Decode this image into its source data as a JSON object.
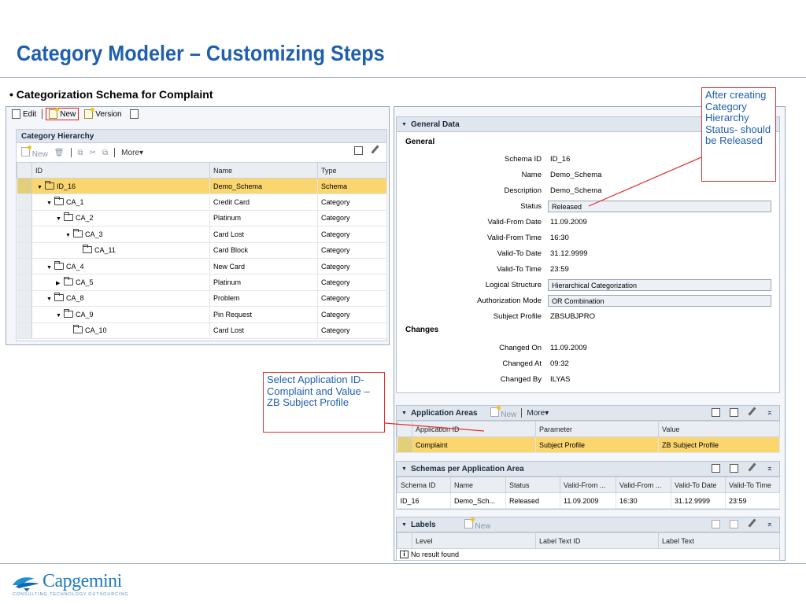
{
  "slide": {
    "title": "Category Modeler – Customizing Steps",
    "bullet": "• Categorization Schema for Complaint"
  },
  "left_window": {
    "toolbar": {
      "edit": "Edit",
      "new": "New",
      "version": "Version"
    },
    "panel_title": "Category Hierarchy",
    "panel_toolbar": {
      "new": "New",
      "more": "More"
    },
    "columns": [
      "ID",
      "Name",
      "Type"
    ],
    "rows": [
      {
        "id": "ID_16",
        "name": "Demo_Schema",
        "type": "Schema",
        "level": 1,
        "toggle": "down",
        "highlighted": true
      },
      {
        "id": "CA_1",
        "name": "Credit Card",
        "type": "Category",
        "level": 2,
        "toggle": "down"
      },
      {
        "id": "CA_2",
        "name": "Platinum",
        "type": "Category",
        "level": 3,
        "toggle": "down"
      },
      {
        "id": "CA_3",
        "name": "Card Lost",
        "type": "Category",
        "level": 4,
        "toggle": "down"
      },
      {
        "id": "CA_11",
        "name": "Card Block",
        "type": "Category",
        "level": 5,
        "toggle": "none"
      },
      {
        "id": "CA_4",
        "name": "New Card",
        "type": "Category",
        "level": 2,
        "toggle": "down"
      },
      {
        "id": "CA_5",
        "name": "Platinum",
        "type": "Category",
        "level": 3,
        "toggle": "right"
      },
      {
        "id": "CA_8",
        "name": "Problem",
        "type": "Category",
        "level": 2,
        "toggle": "down"
      },
      {
        "id": "CA_9",
        "name": "Pin Request",
        "type": "Category",
        "level": 3,
        "toggle": "down"
      },
      {
        "id": "CA_10",
        "name": "Card Lost",
        "type": "Category",
        "level": 4,
        "toggle": "none"
      }
    ]
  },
  "general_data": {
    "title": "General Data",
    "general_label": "General",
    "changes_label": "Changes",
    "fields": [
      {
        "label": "Schema ID",
        "value": "ID_16",
        "boxed": false
      },
      {
        "label": "Name",
        "value": "Demo_Schema",
        "boxed": false
      },
      {
        "label": "Description",
        "value": "Demo_Schema",
        "boxed": false
      },
      {
        "label": "Status",
        "value": "Released",
        "boxed": true
      },
      {
        "label": "Valid-From Date",
        "value": "11.09.2009",
        "boxed": false
      },
      {
        "label": "Valid-From Time",
        "value": "16:30",
        "boxed": false
      },
      {
        "label": "Valid-To Date",
        "value": "31.12.9999",
        "boxed": false
      },
      {
        "label": "Valid-To Time",
        "value": "23:59",
        "boxed": false
      },
      {
        "label": "Logical Structure",
        "value": "Hierarchical Categorization",
        "boxed": true
      },
      {
        "label": "Authorization Mode",
        "value": "OR Combination",
        "boxed": true
      },
      {
        "label": "Subject Profile",
        "value": "ZBSUBJPRO",
        "boxed": false
      }
    ],
    "changes": [
      {
        "label": "Changed On",
        "value": "11.09.2009"
      },
      {
        "label": "Changed At",
        "value": "09:32"
      },
      {
        "label": "Changed By",
        "value": "ILYAS"
      }
    ]
  },
  "application_areas": {
    "title": "Application Areas",
    "new": "New",
    "more": "More",
    "columns": [
      "Application ID",
      "Parameter",
      "Value"
    ],
    "rows": [
      {
        "app": "Complaint",
        "parameter": "Subject Profile",
        "value": "ZB Subject Profile"
      }
    ]
  },
  "schemas": {
    "title": "Schemas per Application Area",
    "columns": [
      "Schema ID",
      "Name",
      "Status",
      "Valid-From ...",
      "Valid-From ...",
      "Valid-To Date",
      "Valid-To Time"
    ],
    "rows": [
      [
        "ID_16",
        "Demo_Sch...",
        "Released",
        "11.09.2009",
        "16:30",
        "31.12.9999",
        "23:59"
      ]
    ]
  },
  "labels": {
    "title": "Labels",
    "new": "New",
    "columns": [
      "Level",
      "Label Text ID",
      "Label Text"
    ],
    "empty_message": "No result found"
  },
  "callouts": {
    "status": "After creating Category Hierarchy Status- should be Released",
    "application": "Select Application ID-Complaint  and Value –ZB Subject Profile"
  },
  "logo": {
    "word": "Capgemini",
    "tagline": "CONSULTING.TECHNOLOGY.OUTSOURCING"
  },
  "colors": {
    "title": "#1f5fae",
    "highlight_row": "#fbd56e",
    "callout_border": "#e23030"
  }
}
